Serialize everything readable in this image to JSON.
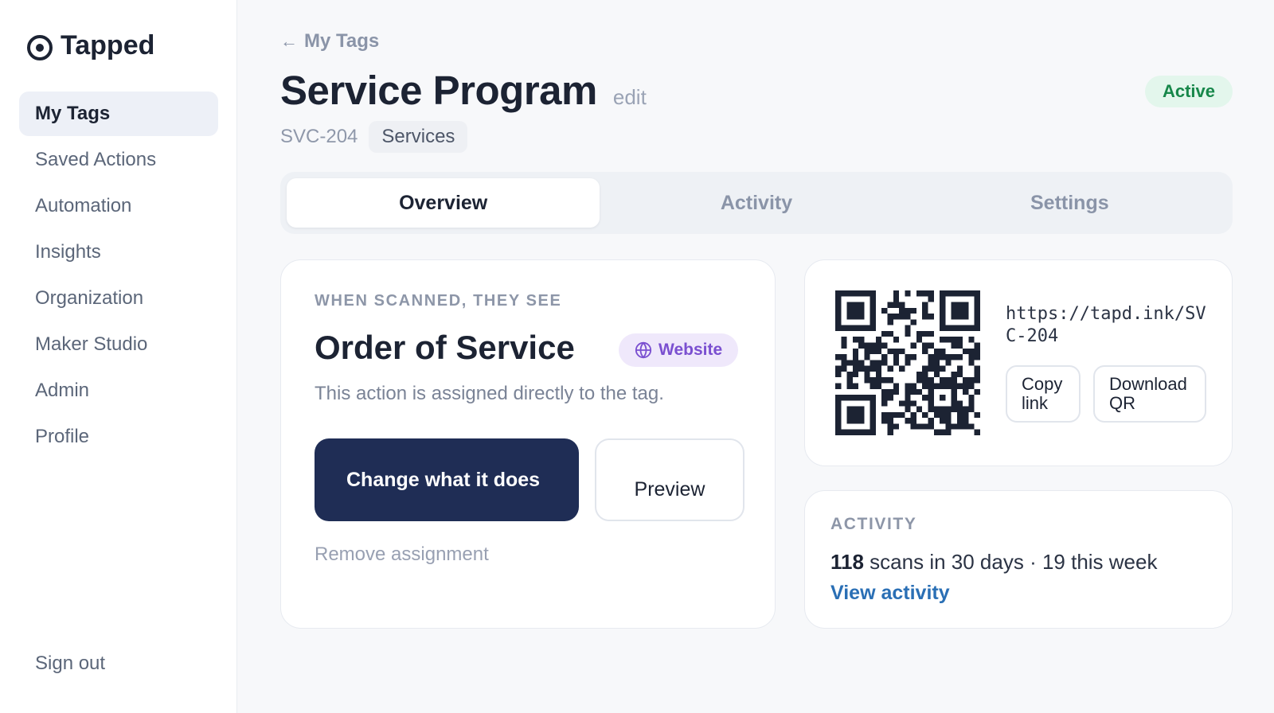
{
  "app": {
    "name": "Tapped",
    "logo_icon": "target-icon"
  },
  "sidebar": {
    "items": [
      {
        "label": "My Tags",
        "active": true
      },
      {
        "label": "Saved Actions"
      },
      {
        "label": "Automation"
      },
      {
        "label": "Insights"
      },
      {
        "label": "Organization"
      },
      {
        "label": "Maker Studio"
      },
      {
        "label": "Admin"
      },
      {
        "label": "Profile"
      }
    ],
    "sign_out": "Sign out"
  },
  "header": {
    "back_arrow": "←",
    "back_label": "My Tags",
    "title": "Service Program",
    "edit_label": "edit",
    "status": "Active",
    "tag_code": "SVC-204",
    "category": "Services"
  },
  "tabs": [
    {
      "label": "Overview",
      "active": true
    },
    {
      "label": "Activity"
    },
    {
      "label": "Settings"
    }
  ],
  "action_card": {
    "eyebrow": "WHEN SCANNED, THEY SEE",
    "title": "Order of Service",
    "type_label": "Website",
    "type_icon": "globe-icon",
    "description": "This action is assigned directly to the tag.",
    "primary_button": "Change what it does",
    "secondary_button": "Preview",
    "remove_link": "Remove assignment"
  },
  "qr_card": {
    "url": "https://tapd.ink/SVC-204",
    "copy_button": "Copy link",
    "download_button": "Download QR"
  },
  "activity_card": {
    "eyebrow": "ACTIVITY",
    "scan_count": "118",
    "scan_text": " scans in 30 days · 19 this week",
    "link": "View activity"
  },
  "colors": {
    "primary": "#1f2d55",
    "status_bg": "#e3f6ec",
    "status_text": "#17874a",
    "chip_bg": "#efe8fb",
    "chip_text": "#7a4fd0",
    "link": "#2a6fb5"
  }
}
